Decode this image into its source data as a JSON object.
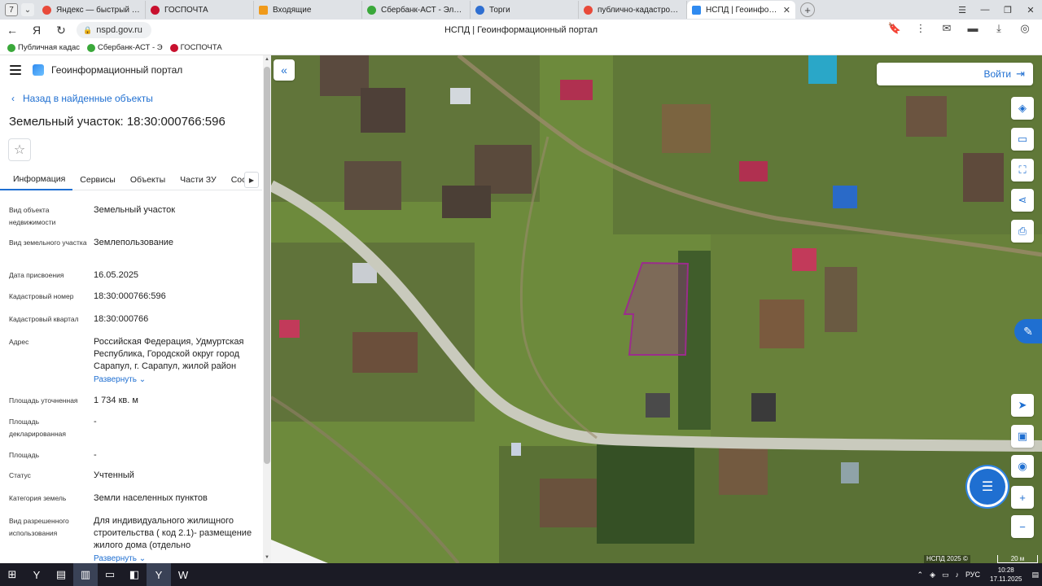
{
  "browser": {
    "tab_count": "7",
    "tabs": [
      {
        "title": "Яндекс — быстрый поиск",
        "color": "#e84a3a"
      },
      {
        "title": "ГОСПОЧТА",
        "color": "#c8102e"
      },
      {
        "title": "Входящие",
        "color": "#f09a1a"
      },
      {
        "title": "Сбербанк-АСТ - Электро",
        "color": "#3aa83a"
      },
      {
        "title": "Торги",
        "color": "#2f6fd1"
      },
      {
        "title": "публично-кадастровая к",
        "color": "#e84a3a"
      },
      {
        "title": "НСПД | Геоинформаци",
        "color": "#2f8af0",
        "close": "✕"
      }
    ],
    "url": "nspd.gov.ru",
    "page_title": "НСПД | Геоинформационный портал",
    "bookmarks": [
      {
        "title": "Публичная кадас",
        "color": "#3aa83a"
      },
      {
        "title": "Сбербанк-АСТ - Э",
        "color": "#3aa83a"
      },
      {
        "title": "ГОСПОЧТА",
        "color": "#c8102e"
      }
    ]
  },
  "app": {
    "title": "Геоинформационный портал",
    "back_link": "Назад в найденные объекты",
    "object_title": "Земельный участок: 18:30:000766:596",
    "tabs": [
      "Информация",
      "Сервисы",
      "Объекты",
      "Части ЗУ",
      "Соста"
    ],
    "attributes": [
      {
        "label": "Вид объекта недвижимости",
        "value": "Земельный участок"
      },
      {
        "label": "Вид земельного участка",
        "value": "Землепользование"
      },
      {
        "label": "Дата присвоения",
        "value": "16.05.2025"
      },
      {
        "label": "Кадастровый номер",
        "value": "18:30:000766:596"
      },
      {
        "label": "Кадастровый квартал",
        "value": "18:30:000766"
      },
      {
        "label": "Адрес",
        "value": "Российская Федерация, Удмуртская Республика, Городской округ город Сарапул, г. Сарапул, жилой район",
        "expand": "Развернуть"
      },
      {
        "label": "Площадь уточненная",
        "value": "1 734 кв. м"
      },
      {
        "label": "Площадь декларированная",
        "value": "-"
      },
      {
        "label": "Площадь",
        "value": "-"
      },
      {
        "label": "Статус",
        "value": "Учтенный"
      },
      {
        "label": "Категория земель",
        "value": "Земли населенных пунктов"
      },
      {
        "label": "Вид разрешенного использования",
        "value": "Для индивидуального жилищного строительства ( код 2.1)- размещение жилого дома (отдельно",
        "expand": "Развернуть"
      }
    ]
  },
  "map": {
    "login": "Войти",
    "attribution": "НСПД 2025 ©",
    "scale": "20 м",
    "parcel_color": "#9b2d8c"
  },
  "taskbar": {
    "lang": "РУС",
    "time": "10:28",
    "date": "17.11.2025"
  }
}
